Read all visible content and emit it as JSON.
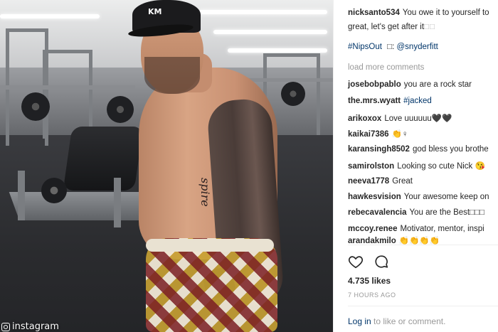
{
  "photo": {
    "cap_logo": "KM",
    "tattoo_text": "spire",
    "watermark": "instagram"
  },
  "caption": {
    "user": "nicksanto534",
    "line1": "You owe it to yourself to",
    "line2": "great, let's get after it",
    "hashtag": "#NipsOut",
    "camera_credit_sep": ":",
    "credit_user": "@snyderfitt"
  },
  "load_more": "load more comments",
  "comments": [
    {
      "user": "josebobpablo",
      "text": "you are a rock star"
    },
    {
      "user": "the.mrs.wyatt",
      "text": "#jacked"
    },
    {
      "user": "arikoxox",
      "text": "Love uuuuuu🖤🖤"
    },
    {
      "user": "kaikai7386",
      "text": "👏♀"
    },
    {
      "user": "karansingh8502",
      "text": "god bless you brothe"
    },
    {
      "user": "samirolston",
      "text": "Looking so cute Nick 😘"
    },
    {
      "user": "neeva1778",
      "text": "Great"
    },
    {
      "user": "hawkesvision",
      "text": "Your awesome keep on"
    },
    {
      "user": "rebecavalencia",
      "text": "You are the Best□□□"
    },
    {
      "user": "mccoy.renee",
      "text": "Motivator, mentor, inspi"
    },
    {
      "user": "arandakmilo",
      "text": "👏👏👏👏"
    }
  ],
  "actions": {
    "like_icon": "heart-icon",
    "comment_icon": "speech-bubble-icon"
  },
  "likes": "4.735 likes",
  "timestamp": "7 HOURS AGO",
  "login": {
    "link": "Log in",
    "rest": "to like or comment."
  },
  "colors": {
    "link": "#003569",
    "muted": "#999999",
    "text": "#262626"
  }
}
